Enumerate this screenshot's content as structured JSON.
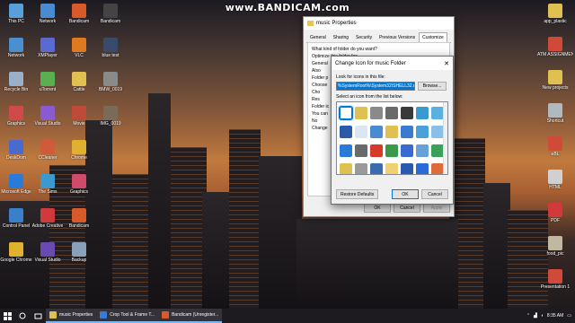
{
  "watermark": "www.BANDICAM.com",
  "desktop_icons_left": [
    {
      "label": "This PC",
      "color": "#5aa0d8"
    },
    {
      "label": "Network",
      "color": "#4a90d0"
    },
    {
      "label": "Recycle Bin",
      "color": "#9ab0c8"
    },
    {
      "label": "Graphics",
      "color": "#d04a4a"
    },
    {
      "label": "DeskDom",
      "color": "#4a6ad0"
    },
    {
      "label": "Microsoft Edge",
      "color": "#2a7ad8"
    },
    {
      "label": "Control Panel",
      "color": "#3a80c8"
    },
    {
      "label": "Google Chrome",
      "color": "#e0b030"
    }
  ],
  "desktop_icons_col2": [
    {
      "label": "Network",
      "color": "#4a8ad0"
    },
    {
      "label": "XMPlayer",
      "color": "#5a6ad0"
    },
    {
      "label": "uTorrent",
      "color": "#5ab050"
    },
    {
      "label": "Visual Studio",
      "color": "#8a5ad0"
    },
    {
      "label": "CCleaner",
      "color": "#d05a3a"
    },
    {
      "label": "The Sims",
      "color": "#3a9ad0"
    },
    {
      "label": "Adobe Creative",
      "color": "#d03a3a"
    },
    {
      "label": "Visual Studio",
      "color": "#6a4ab0"
    }
  ],
  "desktop_icons_col3": [
    {
      "label": "Bandicam",
      "color": "#d85a2a"
    },
    {
      "label": "VLC",
      "color": "#e07a20"
    },
    {
      "label": "Cattle",
      "color": "#e0c050"
    },
    {
      "label": "Movie",
      "color": "#c04a3a"
    },
    {
      "label": "Chrome",
      "color": "#e0b030"
    },
    {
      "label": "Graphics",
      "color": "#d04a6a"
    },
    {
      "label": "Bandicam",
      "color": "#d85a2a"
    },
    {
      "label": "Backup",
      "color": "#8aa0b8"
    }
  ],
  "desktop_icons_col4": [
    {
      "label": "Bandicam",
      "color": "#444"
    },
    {
      "label": "blue test",
      "color": "#3a4a6a"
    },
    {
      "label": "BMW_0019",
      "color": "#8a8a8a"
    },
    {
      "label": "IMG_0019",
      "color": "#7a6a5a"
    }
  ],
  "desktop_icons_right": [
    {
      "label": "app_plastic",
      "color": "#e0c050"
    },
    {
      "label": "ATM ASSIGNMENT",
      "color": "#d04a3a"
    },
    {
      "label": "New projects",
      "color": "#e0c050"
    },
    {
      "label": "Shortcut",
      "color": "#b0b8c0"
    },
    {
      "label": "eBL",
      "color": "#d04a3a"
    },
    {
      "label": "HTML",
      "color": "#d0d0d0"
    },
    {
      "label": "PDF",
      "color": "#d03a3a"
    },
    {
      "label": "food_pic",
      "color": "#c0b8a0"
    },
    {
      "label": "Presentation 1",
      "color": "#d04a3a"
    }
  ],
  "properties_dialog": {
    "title": "music Properties",
    "tabs": [
      "General",
      "Sharing",
      "Security",
      "Previous Versions",
      "Customize"
    ],
    "active_tab": "Customize",
    "body_lines": [
      "What kind of folder do you want?",
      "Optimize this folder for:",
      "General",
      "Also",
      "Folder p",
      "Choose",
      "Cho",
      "Res",
      "Folder ic",
      "You can",
      "No",
      "Change"
    ],
    "buttons": {
      "ok": "OK",
      "cancel": "Cancel",
      "apply": "Apply"
    }
  },
  "change_icon_dialog": {
    "title": "Change Icon for music Folder",
    "close": "✕",
    "look_label": "Look for icons in this file:",
    "path_value": "%SystemRoot%\\System32\\SHELL32.dll",
    "browse_label": "Browse...",
    "select_label": "Select an icon from the list below:",
    "icons": [
      "#ffffff",
      "#e0c050",
      "#8a8a8a",
      "#6a6a6a",
      "#3a3a3a",
      "#3a9ad0",
      "#5ab0e0",
      "#2a5aa8",
      "#dce6f0",
      "#4a8ad0",
      "#e0c050",
      "#3a7ad0",
      "#4aa0d8",
      "#8ac0e8",
      "#2a7ad8",
      "#6a6a6a",
      "#d83a2a",
      "#3a9a4a",
      "#3a6ad0",
      "#6aa0d8",
      "#3aa05a",
      "#e0c050",
      "#9a9a9a",
      "#3a6ab0",
      "#f0d070",
      "#2a5ab0",
      "#2a6ad8",
      "#e06a3a"
    ],
    "restore_label": "Restore Defaults",
    "ok_label": "OK",
    "cancel_label": "Cancel"
  },
  "taskbar": {
    "items": [
      {
        "label": "music Properties",
        "color": "#e0c050"
      },
      {
        "label": "Crop Tool & Frame T...",
        "color": "#3a7ad0"
      },
      {
        "label": "Bandicam (Unregister...",
        "color": "#d85a2a"
      }
    ],
    "clock": "8:35 AM"
  }
}
